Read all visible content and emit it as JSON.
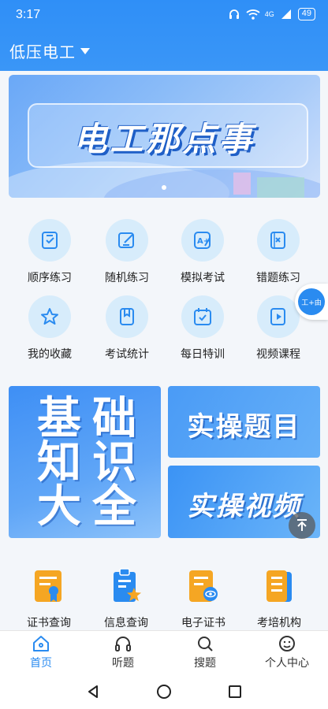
{
  "status": {
    "time": "3:17",
    "network": "4G",
    "battery": "49"
  },
  "header": {
    "title": "低压电工"
  },
  "banner": {
    "title": "电工那点事"
  },
  "features": [
    {
      "label": "顺序练习",
      "icon": "ordered-list-icon"
    },
    {
      "label": "随机练习",
      "icon": "edit-icon"
    },
    {
      "label": "模拟考试",
      "icon": "exam-icon"
    },
    {
      "label": "错题练习",
      "icon": "wrong-icon"
    },
    {
      "label": "我的收藏",
      "icon": "star-icon"
    },
    {
      "label": "考试统计",
      "icon": "bookmark-icon"
    },
    {
      "label": "每日特训",
      "icon": "calendar-icon"
    },
    {
      "label": "视频课程",
      "icon": "video-icon"
    }
  ],
  "float_badge": {
    "label": "工+由"
  },
  "cards": {
    "basics": {
      "lines": [
        "基",
        "础",
        "知",
        "识",
        "大",
        "全"
      ]
    },
    "practice": {
      "label": "实操题目"
    },
    "video": {
      "label": "实操视频"
    }
  },
  "services": [
    {
      "label": "证书查询",
      "icon": "certificate-icon"
    },
    {
      "label": "信息查询",
      "icon": "clipboard-star-icon"
    },
    {
      "label": "电子证书",
      "icon": "e-certificate-icon"
    },
    {
      "label": "考培机构",
      "icon": "institution-icon"
    }
  ],
  "tabs": [
    {
      "label": "首页",
      "icon": "home-icon",
      "active": true
    },
    {
      "label": "听题",
      "icon": "headphones-icon",
      "active": false
    },
    {
      "label": "搜题",
      "icon": "search-icon",
      "active": false
    },
    {
      "label": "个人中心",
      "icon": "profile-icon",
      "active": false
    }
  ],
  "colors": {
    "primary": "#2a8bf0",
    "icon_bg": "#d7ecfb",
    "service_orange": "#f5a623"
  }
}
